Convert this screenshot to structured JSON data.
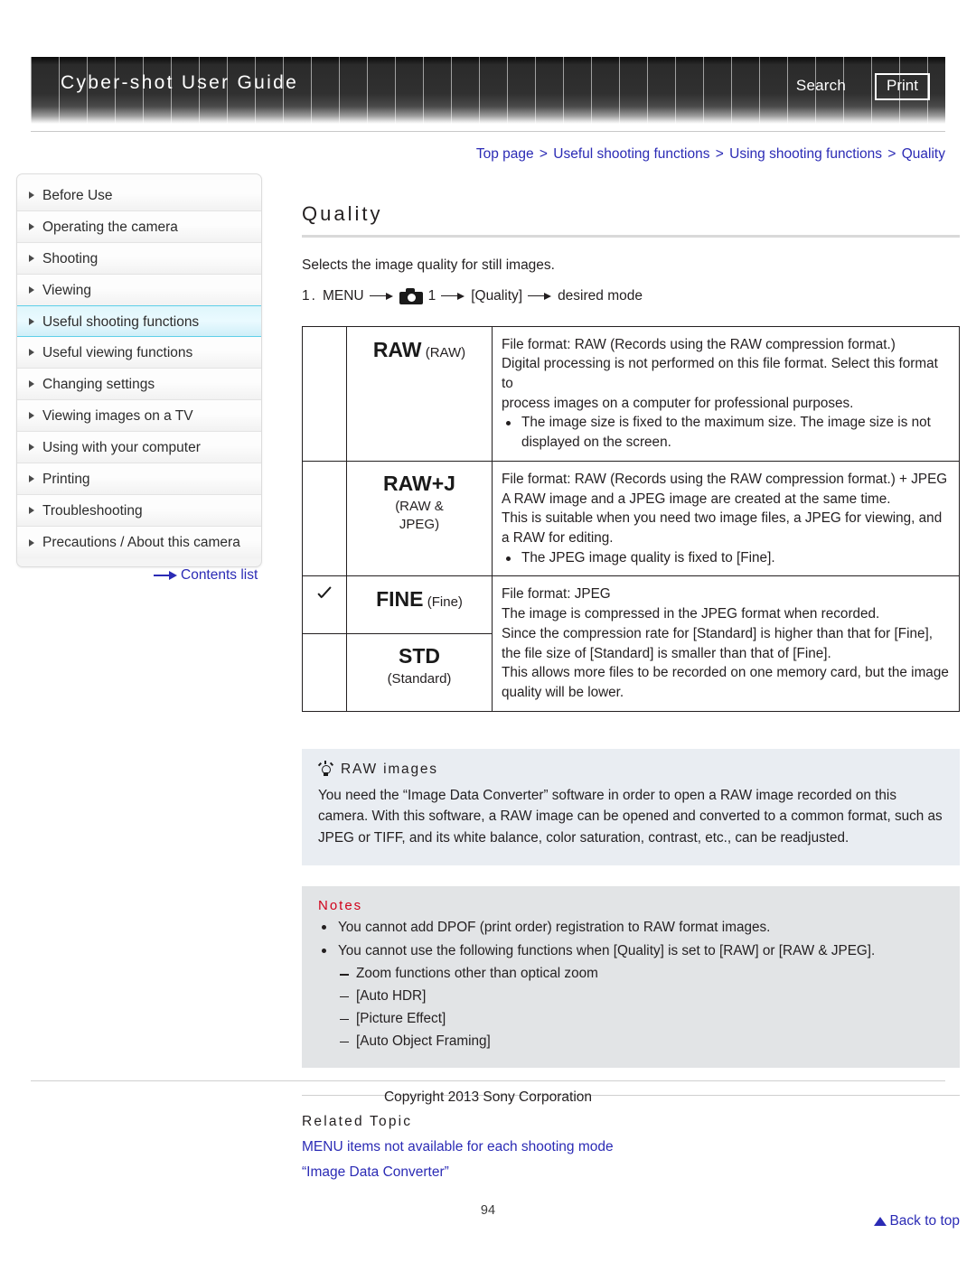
{
  "header": {
    "title": "Cyber-shot User Guide",
    "search_label": "Search",
    "print_label": "Print"
  },
  "breadcrumb": {
    "items": [
      "Top page",
      "Useful shooting functions",
      "Using shooting functions",
      "Quality"
    ],
    "separator": ">",
    "full_text": "Top page > Useful shooting functions > Using shooting functions > Quality"
  },
  "sidebar": {
    "items": [
      {
        "label": "Before Use",
        "active": false
      },
      {
        "label": "Operating the camera",
        "active": false
      },
      {
        "label": "Shooting",
        "active": false
      },
      {
        "label": "Viewing",
        "active": false
      },
      {
        "label": "Useful shooting functions",
        "active": true
      },
      {
        "label": "Useful viewing functions",
        "active": false
      },
      {
        "label": "Changing settings",
        "active": false
      },
      {
        "label": "Viewing images on a TV",
        "active": false
      },
      {
        "label": "Using with your computer",
        "active": false
      },
      {
        "label": "Printing",
        "active": false
      },
      {
        "label": "Troubleshooting",
        "active": false
      },
      {
        "label": "Precautions / About this camera",
        "active": false
      }
    ],
    "contents_list_label": "Contents list"
  },
  "main": {
    "title": "Quality",
    "intro": "Selects the image quality for still images.",
    "step": {
      "number": "1.",
      "menu_label": "MENU",
      "camera_index": "1",
      "item_label": "[Quality]",
      "result_label": "desired mode"
    },
    "table": {
      "rows": [
        {
          "checked": false,
          "glyph": "RAW",
          "glyph_sub": "(RAW)",
          "sub_lines": [],
          "desc_lines": [
            "File format: RAW (Records using the RAW compression format.)",
            "Digital processing is not performed on this file format. Select this format to",
            "process images on a computer for professional purposes."
          ],
          "bullets": [
            "The image size is fixed to the maximum size. The image size is not displayed on the screen."
          ]
        },
        {
          "checked": false,
          "glyph": "RAW+J",
          "glyph_sub": "",
          "sub_lines": [
            "(RAW &",
            "JPEG)"
          ],
          "desc_lines": [
            "File format: RAW (Records using the RAW compression format.) + JPEG",
            "A RAW image and a JPEG image are created at the same time.",
            "This is suitable when you need two image files, a JPEG for viewing, and a RAW for editing."
          ],
          "bullets": [
            "The JPEG image quality is fixed to [Fine]."
          ]
        }
      ],
      "merged_row": {
        "modes": [
          {
            "checked": true,
            "glyph": "FINE",
            "glyph_sub": "(Fine)",
            "sub_lines": []
          },
          {
            "checked": false,
            "glyph": "STD",
            "glyph_sub": "",
            "sub_lines": [
              "(Standard)"
            ]
          }
        ],
        "desc_lines": [
          "File format: JPEG",
          "The image is compressed in the JPEG format when recorded.",
          "Since the compression rate for [Standard] is higher than that for [Fine], the file size of [Standard] is smaller than that of [Fine].",
          "This allows more files to be recorded on one memory card, but the image quality will be lower."
        ]
      }
    },
    "tip": {
      "heading": "RAW images",
      "body": "You need the “Image Data Converter” software in order to open a RAW image recorded on this camera. With this software, a RAW image can be opened and converted to a common format, such as JPEG or TIFF, and its white balance, color saturation, contrast, etc., can be readjusted."
    },
    "notes": {
      "heading": "Notes",
      "items": [
        {
          "text": "You cannot add DPOF (print order) registration to RAW format images.",
          "sub": []
        },
        {
          "text": "You cannot use the following functions when [Quality] is set to [RAW] or [RAW & JPEG].",
          "sub": [
            "Zoom functions other than optical zoom",
            "[Auto HDR]",
            "[Picture Effect]",
            "[Auto Object Framing]"
          ]
        }
      ]
    },
    "related": {
      "heading": "Related Topic",
      "links": [
        "MENU items not available for each shooting mode",
        "“Image Data Converter”"
      ]
    },
    "back_to_top": "Back to top"
  },
  "footer": {
    "copyright": "Copyright 2013 Sony Corporation",
    "page_number": "94"
  },
  "colors": {
    "link": "#2b2bb5",
    "notes_heading": "#d0021b",
    "tip_background": "#e9edf2",
    "notes_background": "#e2e4e6",
    "active_nav": "#5fcfe8"
  }
}
